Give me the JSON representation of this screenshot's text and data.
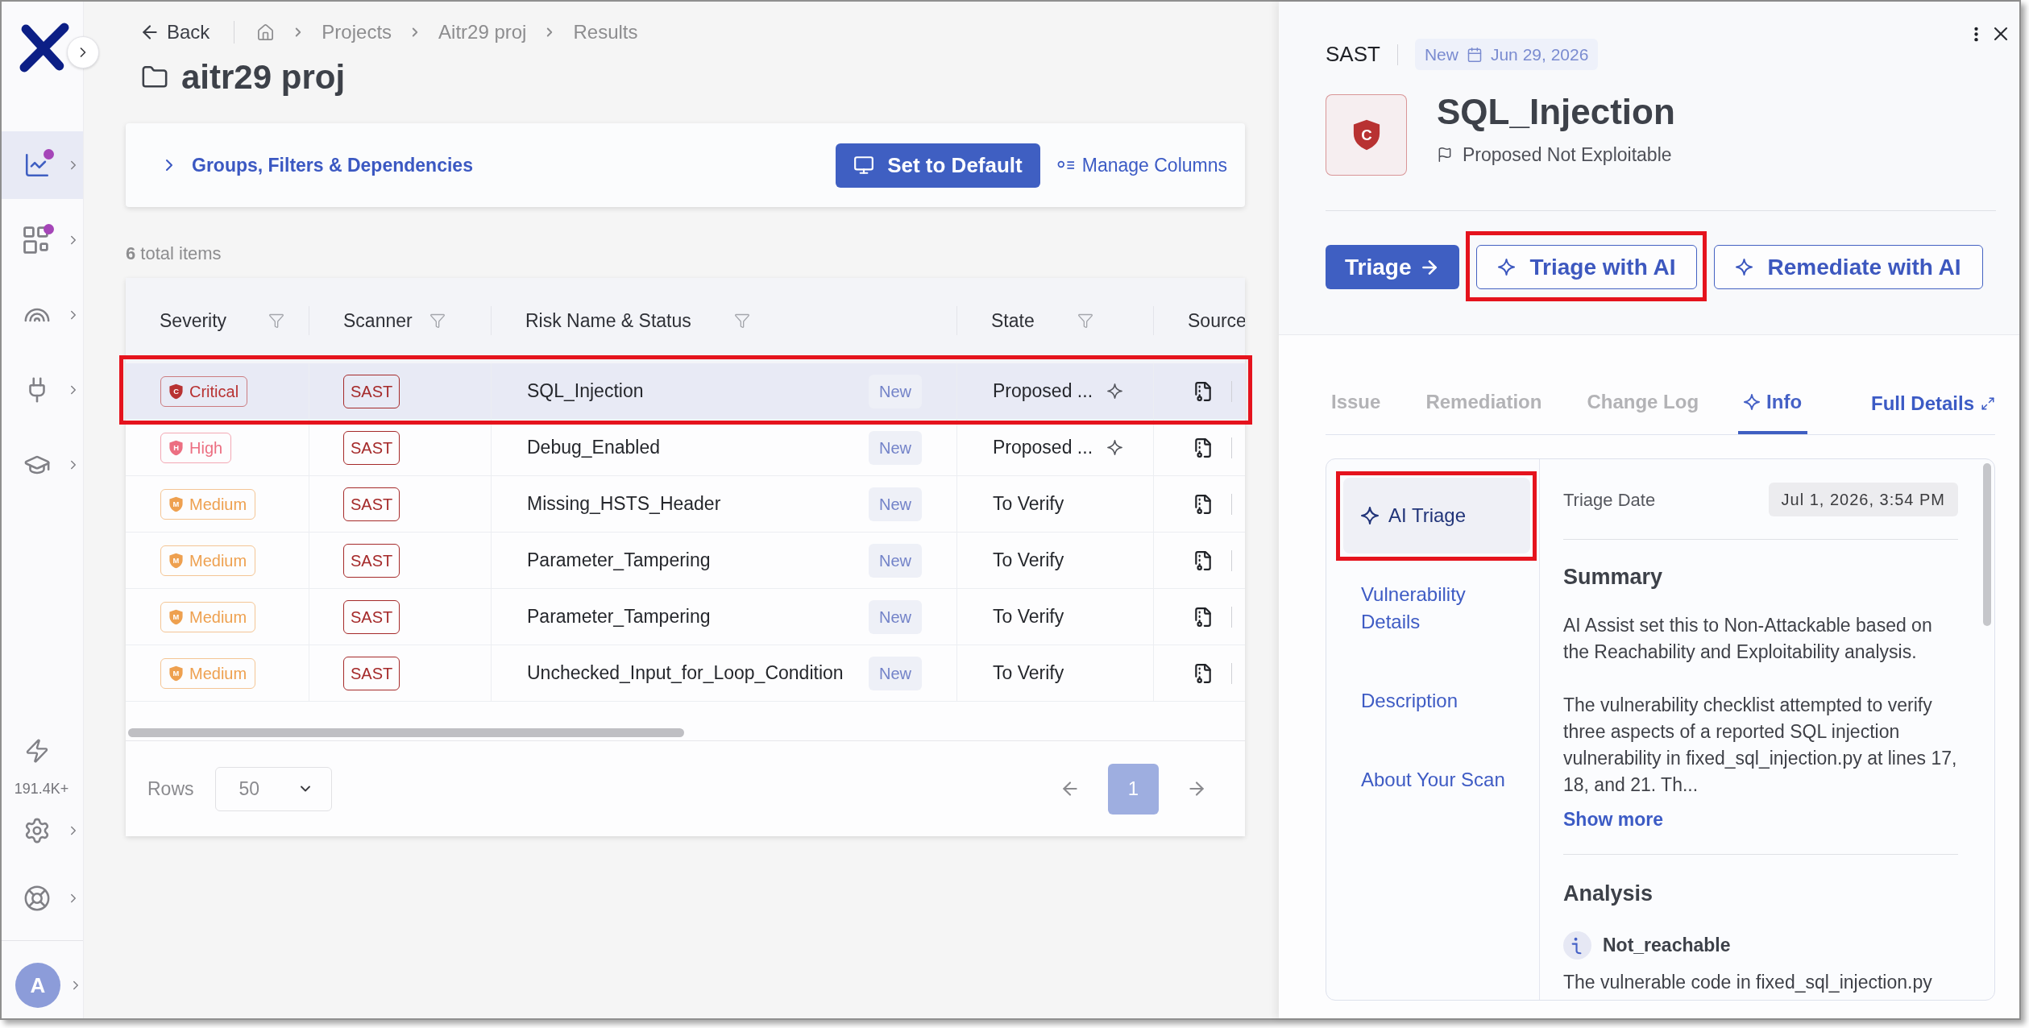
{
  "sidebar": {
    "items": [
      {
        "selected": true,
        "dot": true
      },
      {
        "selected": false,
        "dot": true
      },
      {
        "selected": false,
        "dot": false
      },
      {
        "selected": false,
        "dot": false
      },
      {
        "selected": false,
        "dot": false
      }
    ],
    "credits": "191.4K+",
    "user": {
      "initial": "A"
    }
  },
  "header": {
    "back": "Back",
    "breadcrumbs": [
      "Projects",
      "Aitr29 proj",
      "Results"
    ],
    "title": "aitr29 proj"
  },
  "toolbar": {
    "filters": {
      "label": "Groups, Filters & Dependencies",
      "expanded": false
    },
    "set_default": "Set to Default",
    "manage_columns": "Manage Columns"
  },
  "total": "**6** total items",
  "table": {
    "columns": [
      {
        "label": "Severity",
        "filter": true
      },
      {
        "label": "Scanner",
        "filter": true
      },
      {
        "label": "Risk Name & Status",
        "filter": true
      },
      {
        "label": "State",
        "filter": true
      },
      {
        "label": "Source",
        "filter": false
      }
    ],
    "rows": [
      {
        "severity": {
          "label": "Critical",
          "letter": "C",
          "color": "#b83232"
        },
        "scanner": "SAST",
        "name": "SQL_Injection",
        "status": "New",
        "state": "Proposed ...",
        "ai": true,
        "selected": true,
        "highlighted": true
      },
      {
        "severity": {
          "label": "High",
          "letter": "H",
          "color": "#ec6f82"
        },
        "scanner": "SAST",
        "name": "Debug_Enabled",
        "status": "New",
        "state": "Proposed ...",
        "ai": true,
        "selected": false,
        "highlighted": false
      },
      {
        "severity": {
          "label": "Medium",
          "letter": "M",
          "color": "#eea04f"
        },
        "scanner": "SAST",
        "name": "Missing_HSTS_Header",
        "status": "New",
        "state": "To Verify",
        "ai": false,
        "selected": false,
        "highlighted": false
      },
      {
        "severity": {
          "label": "Medium",
          "letter": "M",
          "color": "#eea04f"
        },
        "scanner": "SAST",
        "name": "Parameter_Tampering",
        "status": "New",
        "state": "To Verify",
        "ai": false,
        "selected": false,
        "highlighted": false
      },
      {
        "severity": {
          "label": "Medium",
          "letter": "M",
          "color": "#eea04f"
        },
        "scanner": "SAST",
        "name": "Parameter_Tampering",
        "status": "New",
        "state": "To Verify",
        "ai": false,
        "selected": false,
        "highlighted": false
      },
      {
        "severity": {
          "label": "Medium",
          "letter": "M",
          "color": "#eea04f"
        },
        "scanner": "SAST",
        "name": "Unchecked_Input_for_Loop_Condition",
        "status": "New",
        "state": "To Verify",
        "ai": false,
        "selected": false,
        "highlighted": false
      }
    ]
  },
  "footer": {
    "rows_label": "Rows",
    "rows_value": "50",
    "pages": [
      {
        "label": "1",
        "selected": true
      }
    ]
  },
  "detail": {
    "scanner": "SAST",
    "status": "New",
    "date": "Jun 29, 2026",
    "severity": {
      "letter": "C",
      "color": "#b83232"
    },
    "title": "SQL_Injection",
    "state": "Proposed Not Exploitable",
    "actions": [
      {
        "label": "Triage",
        "kind": "primary",
        "highlighted": false
      },
      {
        "label": "Triage with AI",
        "kind": "ai",
        "highlighted": true
      },
      {
        "label": "Remediate with AI",
        "kind": "ai",
        "highlighted": false
      }
    ],
    "tabs": [
      {
        "label": "Issue",
        "ai": false,
        "selected": false
      },
      {
        "label": "Remediation",
        "ai": false,
        "selected": false
      },
      {
        "label": "Change Log",
        "ai": false,
        "selected": false
      },
      {
        "label": "Info",
        "ai": true,
        "selected": true
      }
    ],
    "full_details": "Full Details",
    "sections": [
      {
        "label": "AI Triage",
        "ai": true,
        "selected": true,
        "highlighted": true
      },
      {
        "label": "Vulnerability Details",
        "ai": false,
        "selected": false,
        "highlighted": false
      },
      {
        "label": "Description",
        "ai": false,
        "selected": false,
        "highlighted": false
      },
      {
        "label": "About Your Scan",
        "ai": false,
        "selected": false,
        "highlighted": false
      }
    ],
    "triage_date": {
      "label": "Triage Date",
      "value": "Jul 1, 2026, 3:54 PM"
    },
    "summary": {
      "heading": "Summary",
      "paragraphs": [
        "AI Assist set this to Non-Attackable based on the Reachability and Exploitability analysis.",
        "The vulnerability checklist attempted to verify three aspects of a reported SQL injection vulnerability in fixed_sql_injection.py at lines 17, 18, and 21. Th..."
      ],
      "show_more": "Show more"
    },
    "analysis": {
      "heading": "Analysis",
      "items": [
        {
          "title": "Not_reachable",
          "text": "The vulnerable code in fixed_sql_injection.py"
        }
      ]
    }
  }
}
